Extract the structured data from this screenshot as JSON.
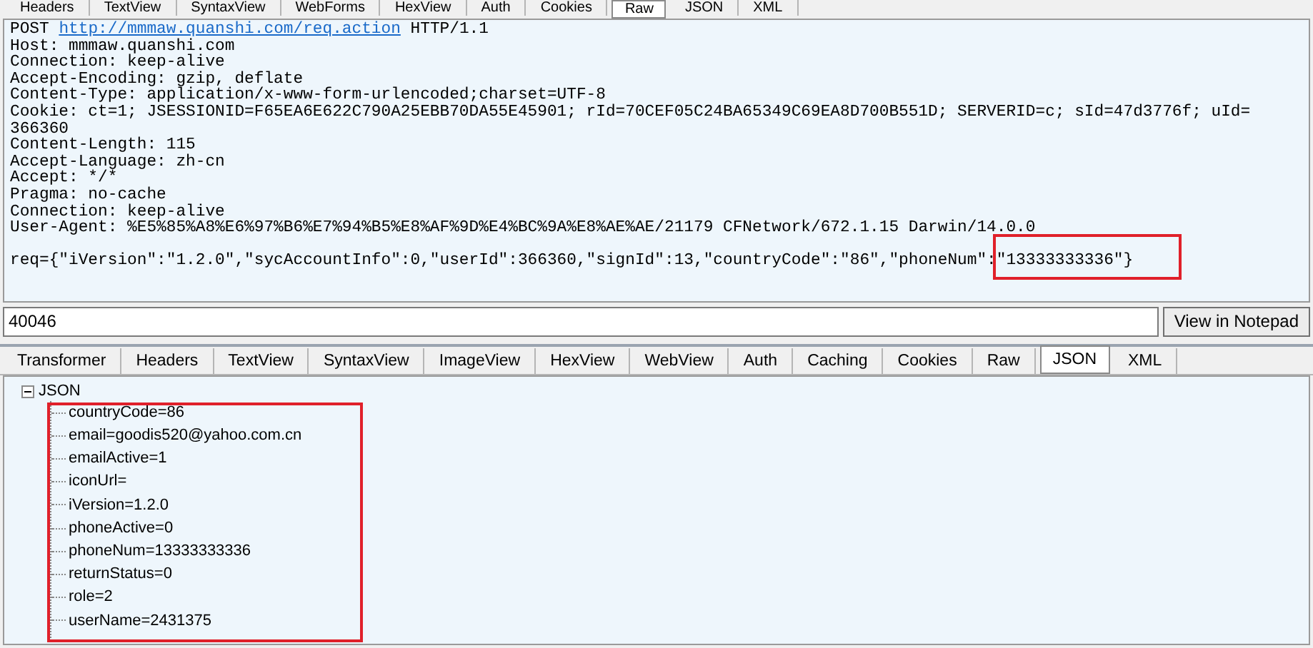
{
  "top_tabs": [
    {
      "label": "Headers",
      "selected": false
    },
    {
      "label": "TextView",
      "selected": false
    },
    {
      "label": "SyntaxView",
      "selected": false
    },
    {
      "label": "WebForms",
      "selected": false
    },
    {
      "label": "HexView",
      "selected": false
    },
    {
      "label": "Auth",
      "selected": false
    },
    {
      "label": "Cookies",
      "selected": false
    },
    {
      "label": "Raw",
      "selected": true
    },
    {
      "label": "JSON",
      "selected": false
    },
    {
      "label": "XML",
      "selected": false
    }
  ],
  "request": {
    "method": "POST",
    "url": "http://mmmaw.quanshi.com/req.action",
    "protocol": "HTTP/1.1",
    "headers": [
      "Host: mmmaw.quanshi.com",
      "Connection: keep-alive",
      "Accept-Encoding: gzip, deflate",
      "Content-Type: application/x-www-form-urlencoded;charset=UTF-8",
      "Cookie: ct=1; JSESSIONID=F65EA6E622C790A25EBB70DA55E45901; rId=70CEF05C24BA65349C69EA8D700B551D; SERVERID=c; sId=47d3776f; uId=",
      "366360",
      "Content-Length: 115",
      "Accept-Language: zh-cn",
      "Accept: */*",
      "Pragma: no-cache",
      "Connection: keep-alive",
      "User-Agent: %E5%85%A8%E6%97%B6%E7%94%B5%E8%AF%9D%E4%BC%9A%E8%AE%AE/21179 CFNetwork/672.1.15 Darwin/14.0.0"
    ],
    "body": "req={\"iVersion\":\"1.2.0\",\"sycAccountInfo\":0,\"userId\":366360,\"signId\":13,\"countryCode\":\"86\",\"phoneNum\":\"13333333336\"}"
  },
  "find_field": {
    "value": "40046"
  },
  "notepad_button": "View in Notepad",
  "response_tabs": [
    {
      "label": "Transformer",
      "selected": false
    },
    {
      "label": "Headers",
      "selected": false
    },
    {
      "label": "TextView",
      "selected": false
    },
    {
      "label": "SyntaxView",
      "selected": false
    },
    {
      "label": "ImageView",
      "selected": false
    },
    {
      "label": "HexView",
      "selected": false
    },
    {
      "label": "WebView",
      "selected": false
    },
    {
      "label": "Auth",
      "selected": false
    },
    {
      "label": "Caching",
      "selected": false
    },
    {
      "label": "Cookies",
      "selected": false
    },
    {
      "label": "Raw",
      "selected": false
    },
    {
      "label": "JSON",
      "selected": true
    },
    {
      "label": "XML",
      "selected": false
    }
  ],
  "tree": {
    "label": "JSON",
    "expanded": true,
    "children": [
      "countryCode=86",
      "email=goodis520@yahoo.com.cn",
      "emailActive=1",
      "iconUrl=",
      "iVersion=1.2.0",
      "phoneActive=0",
      "phoneNum=13333333336",
      "returnStatus=0",
      "role=2",
      "userName=2431375"
    ]
  }
}
